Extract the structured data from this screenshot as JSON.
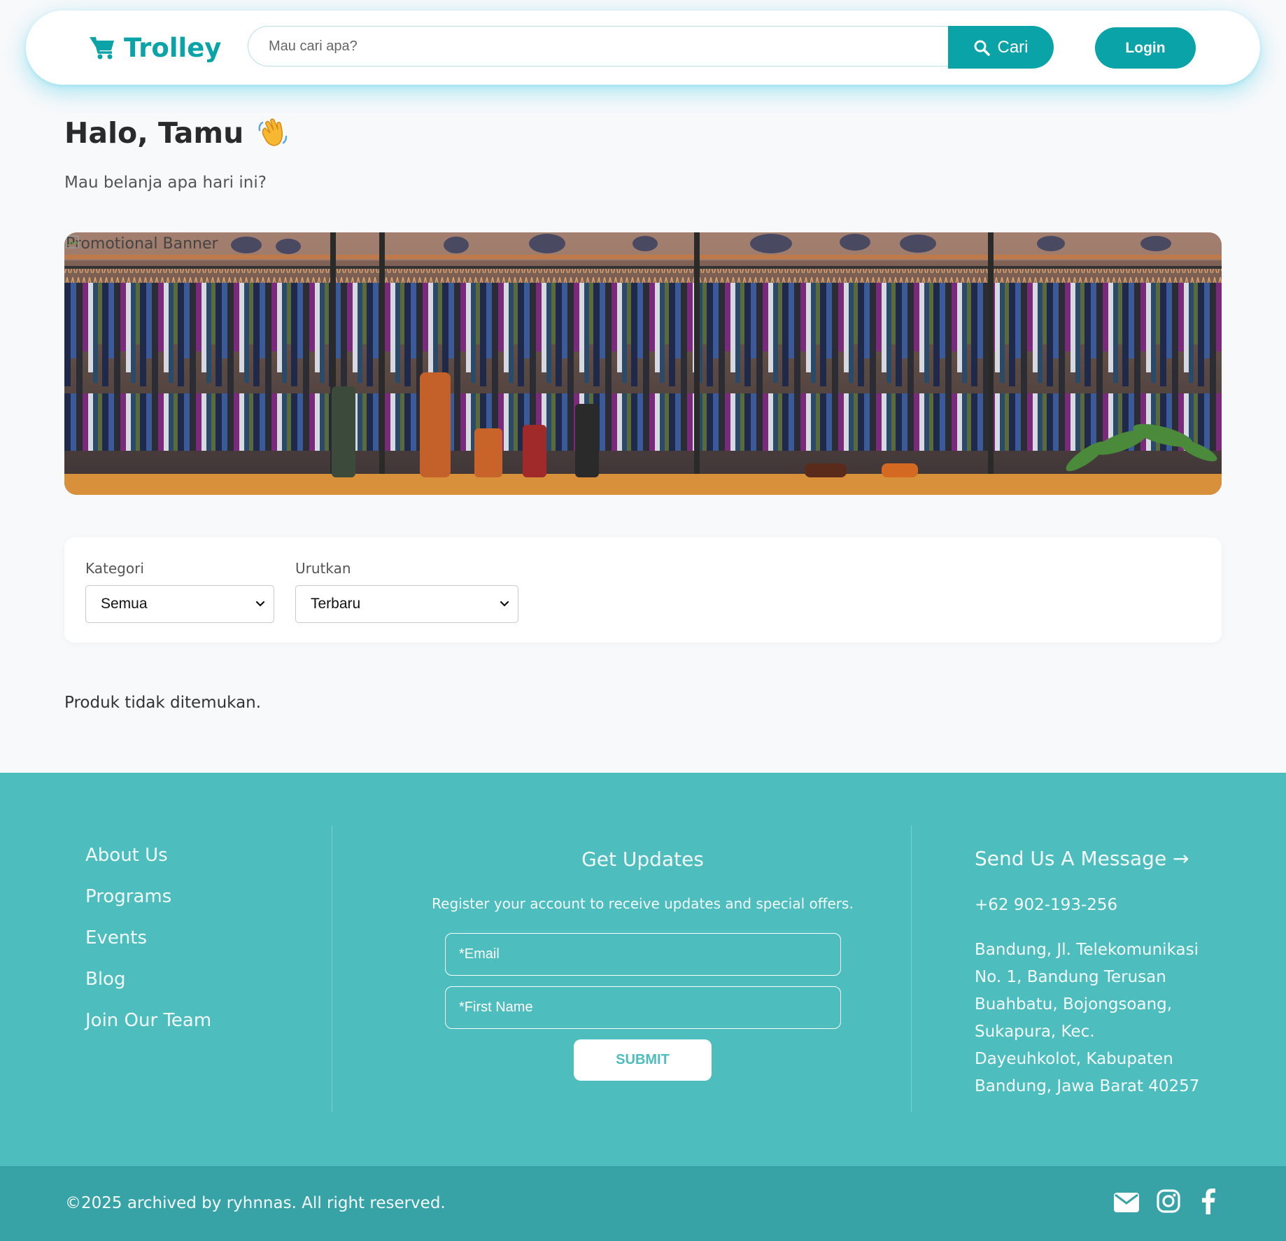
{
  "header": {
    "brand": "Trolley",
    "search_placeholder": "Mau cari apa?",
    "search_button": "Cari",
    "login_button": "Login",
    "accent_color": "#0aa3a8"
  },
  "greeting": {
    "title": "Halo, Tamu",
    "emoji_icon": "waving-hand-icon",
    "subtitle": "Mau belanja apa hari ini?"
  },
  "banner": {
    "alt_text": "Promotional Banner"
  },
  "filters": {
    "category_label": "Kategori",
    "category_value": "Semua",
    "sort_label": "Urutkan",
    "sort_value": "Terbaru"
  },
  "results": {
    "empty_message": "Produk tidak ditemukan."
  },
  "footer": {
    "links": [
      "About Us",
      "Programs",
      "Events",
      "Blog",
      "Join Our Team"
    ],
    "updates_title": "Get Updates",
    "updates_desc": "Register your account to receive updates and special offers.",
    "email_placeholder": "*Email",
    "firstname_placeholder": "*First Name",
    "submit_label": "SUBMIT",
    "message_link": "Send Us A Message →",
    "phone": "+62 902-193-256",
    "address": "Bandung, Jl. Telekomunikasi No. 1, Bandung Terusan Buahbatu, Bojongsoang, Sukapura, Kec. Dayeuhkolot, Kabupaten Bandung, Jawa Barat 40257",
    "copyright": "©2025 archived by ryhnnas. All right reserved.",
    "social_icons": [
      "envelope-icon",
      "instagram-icon",
      "facebook-icon"
    ],
    "background_color": "#4dbdbd",
    "bottom_bar_color": "#37a3a6"
  }
}
